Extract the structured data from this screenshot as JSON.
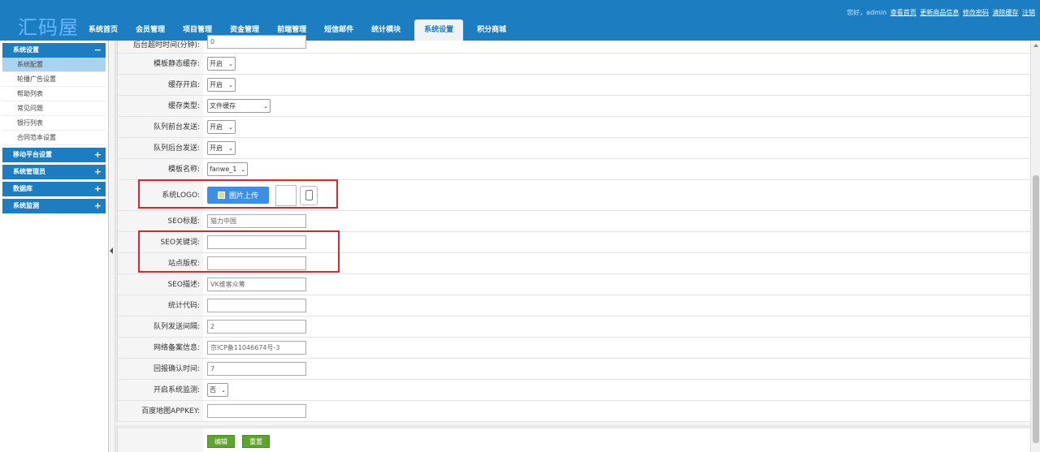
{
  "header": {
    "logo": "汇码屋",
    "nav": [
      "系统首页",
      "会员管理",
      "项目管理",
      "资金管理",
      "前端管理",
      "短信邮件",
      "统计模块",
      "系统设置",
      "积分商城"
    ],
    "active_nav": "系统设置",
    "greeting": "您好，admin",
    "links": [
      "查看首页",
      "更新商品信息",
      "修改密码",
      "清除缓存",
      "注销"
    ]
  },
  "sidebar": {
    "groups": [
      {
        "title": "系统设置",
        "sign": "−",
        "items": [
          "系统配置",
          "轮播广告设置",
          "帮助列表",
          "常见问题",
          "银行列表",
          "合同范本设置"
        ]
      },
      {
        "title": "移动平台设置",
        "sign": "+"
      },
      {
        "title": "系统管理员",
        "sign": "+"
      },
      {
        "title": "数据库",
        "sign": "+"
      },
      {
        "title": "系统监测",
        "sign": "+"
      }
    ],
    "active_item": "系统配置"
  },
  "form": {
    "timeout": {
      "label": "后台超时时间(分钟):",
      "value": "0"
    },
    "tpl_static_cache": {
      "label": "模板静态缓存:",
      "value": "开启"
    },
    "cache_on": {
      "label": "缓存开启:",
      "value": "开启"
    },
    "cache_type": {
      "label": "缓存类型:",
      "value": "文件缓存"
    },
    "queue_front": {
      "label": "队列前台发送:",
      "value": "开启"
    },
    "queue_back": {
      "label": "队列后台发送:",
      "value": "开启"
    },
    "template": {
      "label": "模板名称:",
      "value": "fanwe_1"
    },
    "logo": {
      "label": "系统LOGO:",
      "button": "图片上传"
    },
    "seo_title": {
      "label": "SEO标题:",
      "value": "猫力中国"
    },
    "seo_keywords": {
      "label": "SEO关键词:",
      "value": ""
    },
    "copyright": {
      "label": "站点版权:",
      "value": ""
    },
    "seo_desc": {
      "label": "SEO描述:",
      "value": "VK维客众筹"
    },
    "stat_code": {
      "label": "统计代码:",
      "value": ""
    },
    "queue_interval": {
      "label": "队列发送间隔:",
      "value": "2"
    },
    "icp": {
      "label": "网络备案信息:",
      "value": "京ICP备11046674号-3"
    },
    "confirm_time": {
      "label": "回报确认时间:",
      "value": "7"
    },
    "monitor": {
      "label": "开启系统监测:",
      "value": "否"
    },
    "baidu_key": {
      "label": "百度地图APPKEY:",
      "value": ""
    }
  },
  "buttons": {
    "edit": "编辑",
    "reset": "重置"
  },
  "colors": {
    "header": "#1c7ec1",
    "highlight": "#d9272e",
    "green_button": "#5ea52d"
  }
}
